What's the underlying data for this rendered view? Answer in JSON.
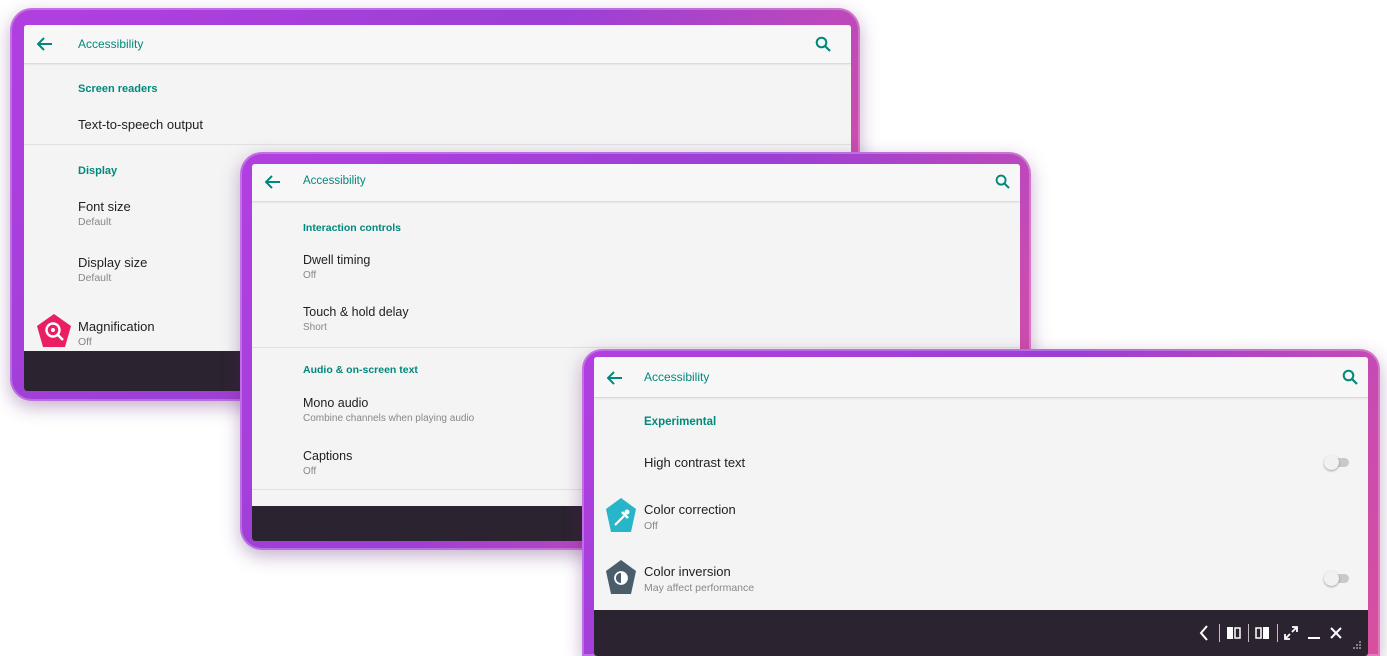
{
  "windows": [
    {
      "title": "Accessibility",
      "sections": [
        {
          "label": "Screen readers",
          "items": [
            {
              "title": "Text-to-speech output",
              "subtitle": ""
            }
          ]
        },
        {
          "label": "Display",
          "items": [
            {
              "title": "Font size",
              "subtitle": "Default"
            },
            {
              "title": "Display size",
              "subtitle": "Default"
            },
            {
              "title": "Magnification",
              "subtitle": "Off",
              "icon": "magnify-icon"
            }
          ]
        }
      ]
    },
    {
      "title": "Accessibility",
      "sections": [
        {
          "label": "Interaction controls",
          "items": [
            {
              "title": "Dwell timing",
              "subtitle": "Off"
            },
            {
              "title": "Touch & hold delay",
              "subtitle": "Short"
            }
          ]
        },
        {
          "label": "Audio & on-screen text",
          "items": [
            {
              "title": "Mono audio",
              "subtitle": "Combine channels when playing audio"
            },
            {
              "title": "Captions",
              "subtitle": "Off"
            }
          ]
        }
      ]
    },
    {
      "title": "Accessibility",
      "sections": [
        {
          "label": "Experimental",
          "items": [
            {
              "title": "High contrast text",
              "subtitle": "",
              "toggle": false
            },
            {
              "title": "Color correction",
              "subtitle": "Off",
              "icon": "eyedropper-icon"
            },
            {
              "title": "Color inversion",
              "subtitle": "May affect performance",
              "icon": "contrast-icon",
              "toggle": false
            }
          ]
        }
      ]
    }
  ],
  "taskbar_icons": [
    "back-icon",
    "snap-left-icon",
    "snap-right-icon",
    "maximize-icon",
    "minimize-icon",
    "close-icon",
    "resize-grip-icon"
  ],
  "colors": {
    "accent": "#00897b",
    "frame": "#a540da",
    "taskbar": "#2c2330",
    "magnify_badge": "#e91e63",
    "color_correction_badge": "#26b5c9",
    "color_inversion_badge": "#4a5d6b"
  }
}
